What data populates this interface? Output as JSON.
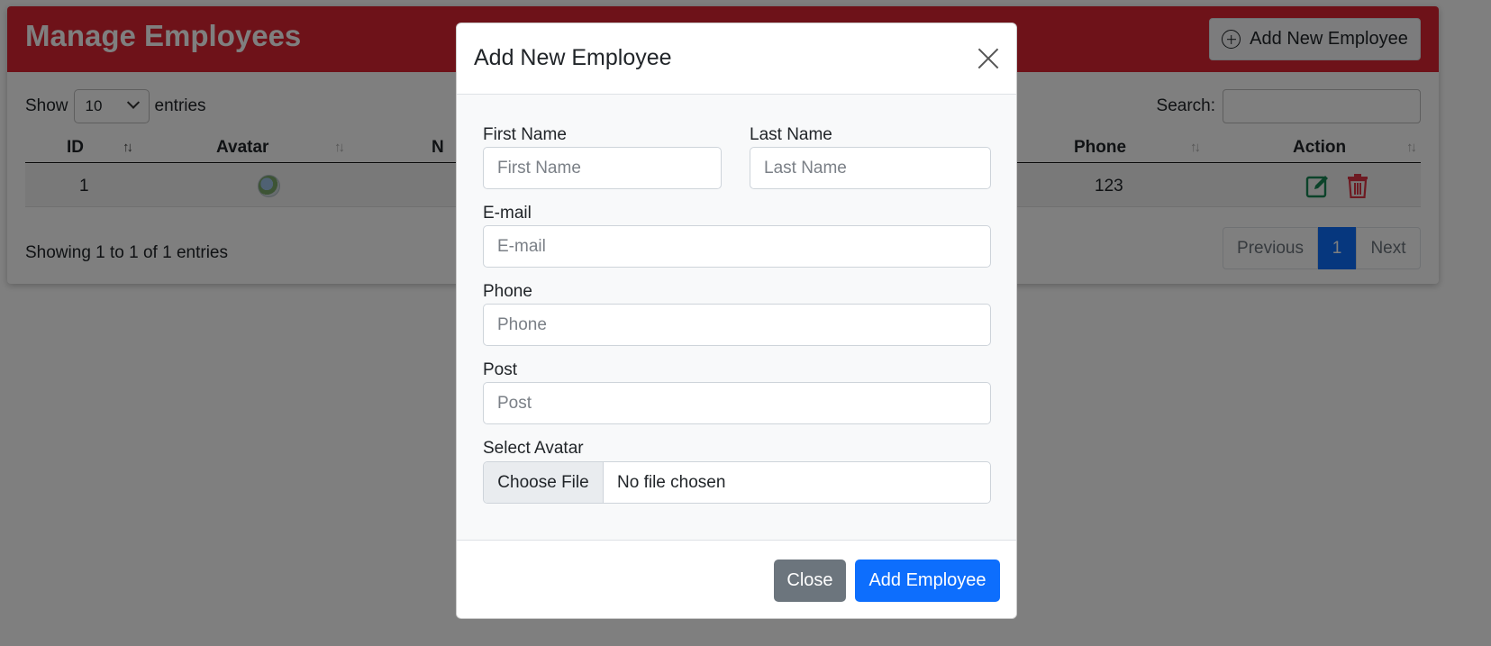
{
  "page": {
    "title": "Manage Employees",
    "add_button_label": "Add New Employee"
  },
  "table_controls": {
    "show_label": "Show",
    "entries_label": "entries",
    "page_length": "10",
    "search_label": "Search:"
  },
  "table": {
    "columns": [
      "ID",
      "Avatar",
      "N",
      "Phone",
      "Action"
    ],
    "rows": [
      {
        "id": "1",
        "phone": "123"
      }
    ]
  },
  "footer": {
    "info": "Showing 1 to 1 of 1 entries",
    "pagination": {
      "previous": "Previous",
      "current": "1",
      "next": "Next"
    }
  },
  "modal": {
    "title": "Add New Employee",
    "fields": {
      "first_name": {
        "label": "First Name",
        "placeholder": "First Name"
      },
      "last_name": {
        "label": "Last Name",
        "placeholder": "Last Name"
      },
      "email": {
        "label": "E-mail",
        "placeholder": "E-mail"
      },
      "phone": {
        "label": "Phone",
        "placeholder": "Phone"
      },
      "post": {
        "label": "Post",
        "placeholder": "Post"
      },
      "avatar": {
        "label": "Select Avatar",
        "button": "Choose File",
        "status": "No file chosen"
      }
    },
    "close_label": "Close",
    "submit_label": "Add Employee"
  },
  "colors": {
    "header_red": "#dc2532",
    "primary_blue": "#0d6efd",
    "secondary_gray": "#6c757d",
    "edit_green": "#198754",
    "delete_red": "#dc3545"
  }
}
